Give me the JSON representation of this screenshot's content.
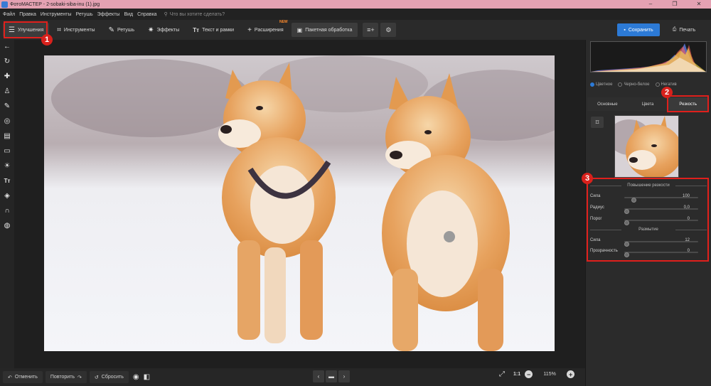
{
  "window": {
    "title": "ФотоМАСТЕР - 2-sobaki-siba-inu (1).jpg",
    "controls": [
      "–",
      "❐",
      "✕"
    ]
  },
  "menu": {
    "items": [
      "Файл",
      "Правка",
      "Инструменты",
      "Ретушь",
      "Эффекты",
      "Вид",
      "Справка"
    ],
    "search_placeholder": "Что вы хотите сделать?"
  },
  "toolbar": {
    "buttons": [
      {
        "label": "Улучшения",
        "icon": "sliders-icon"
      },
      {
        "label": "Инструменты",
        "icon": "crop-icon"
      },
      {
        "label": "Ретушь",
        "icon": "brush-icon"
      },
      {
        "label": "Эффекты",
        "icon": "sparkle-icon"
      },
      {
        "label": "Текст и рамки",
        "icon": "text-icon"
      },
      {
        "label": "Расширения",
        "icon": "plus-icon"
      },
      {
        "label": "Пакетная обработка",
        "icon": "batch-icon"
      }
    ],
    "new_badge": "NEW",
    "save_label": "Сохранить",
    "print_label": "Печать"
  },
  "left_tools": [
    "back-arrow-icon",
    "rotate-icon",
    "bandage-icon",
    "stamp-icon",
    "brush-icon",
    "radial-icon",
    "gradient-icon",
    "vignette-icon",
    "sun-icon",
    "text-icon",
    "fill-icon",
    "magnet-icon",
    "globe-icon"
  ],
  "bottom": {
    "undo_label": "Отменить",
    "redo_label": "Повторить",
    "reset_label": "Сбросить",
    "ratio_label": "1:1",
    "zoom_value": "115%"
  },
  "right_panel": {
    "modes": [
      {
        "label": "Цветное",
        "selected": true
      },
      {
        "label": "Черно-белое",
        "selected": false
      },
      {
        "label": "Негатив",
        "selected": false
      }
    ],
    "tabs": [
      {
        "label": "Основные",
        "active": false
      },
      {
        "label": "Цвета",
        "active": false
      },
      {
        "label": "Резкость",
        "active": true
      }
    ],
    "sharpen": {
      "title": "Повышение резкости",
      "sliders": [
        {
          "label": "Сила",
          "value": "100",
          "fraction": 0.1
        },
        {
          "label": "Радиус",
          "value": "0,0",
          "fraction": 0.0
        },
        {
          "label": "Порог",
          "value": "0",
          "fraction": 0.0
        }
      ]
    },
    "blur": {
      "title": "Размытие",
      "sliders": [
        {
          "label": "Сила",
          "value": "12",
          "fraction": 0.0
        },
        {
          "label": "Прозрачность",
          "value": "0",
          "fraction": 0.0
        }
      ]
    }
  },
  "annotations": {
    "badges": [
      "1",
      "2",
      "3"
    ],
    "color": "#e0201c"
  },
  "colors": {
    "accent": "#2c7ad6",
    "new_badge": "#ff8a2a"
  }
}
